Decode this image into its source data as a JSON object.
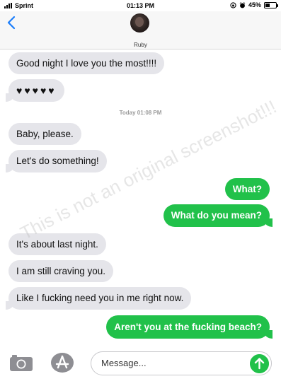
{
  "status_bar": {
    "carrier": "Sprint",
    "time": "01:13 PM",
    "battery_percent": "45%",
    "battery_level": 0.45
  },
  "header": {
    "contact_name": "Ruby"
  },
  "messages": [
    {
      "direction": "received",
      "text": "Good night I love you the most!!!!"
    },
    {
      "direction": "received",
      "text": "♥♥♥♥♥"
    },
    {
      "direction": "received",
      "text": "Baby, please."
    },
    {
      "direction": "received",
      "text": "Let's do something!"
    },
    {
      "direction": "sent",
      "text": "What?"
    },
    {
      "direction": "sent",
      "text": "What do you mean?"
    },
    {
      "direction": "received",
      "text": "It's about last night."
    },
    {
      "direction": "received",
      "text": "I am still craving you."
    },
    {
      "direction": "received",
      "text": "Like I fucking need you in me right now."
    },
    {
      "direction": "sent",
      "text": "Aren't you at the fucking beach?"
    }
  ],
  "timestamp": "Today 01:08 PM",
  "watermark": "This is not an original screenshot!!!",
  "composer": {
    "placeholder": "Message..."
  },
  "icons": {
    "back": "chevron-left-icon",
    "camera": "camera-icon",
    "appstore": "app-store-icon",
    "send": "send-arrow-icon"
  },
  "colors": {
    "sent_bubble": "#21c14a",
    "received_bubble": "#e5e5ea",
    "accent": "#1a7dfa"
  }
}
